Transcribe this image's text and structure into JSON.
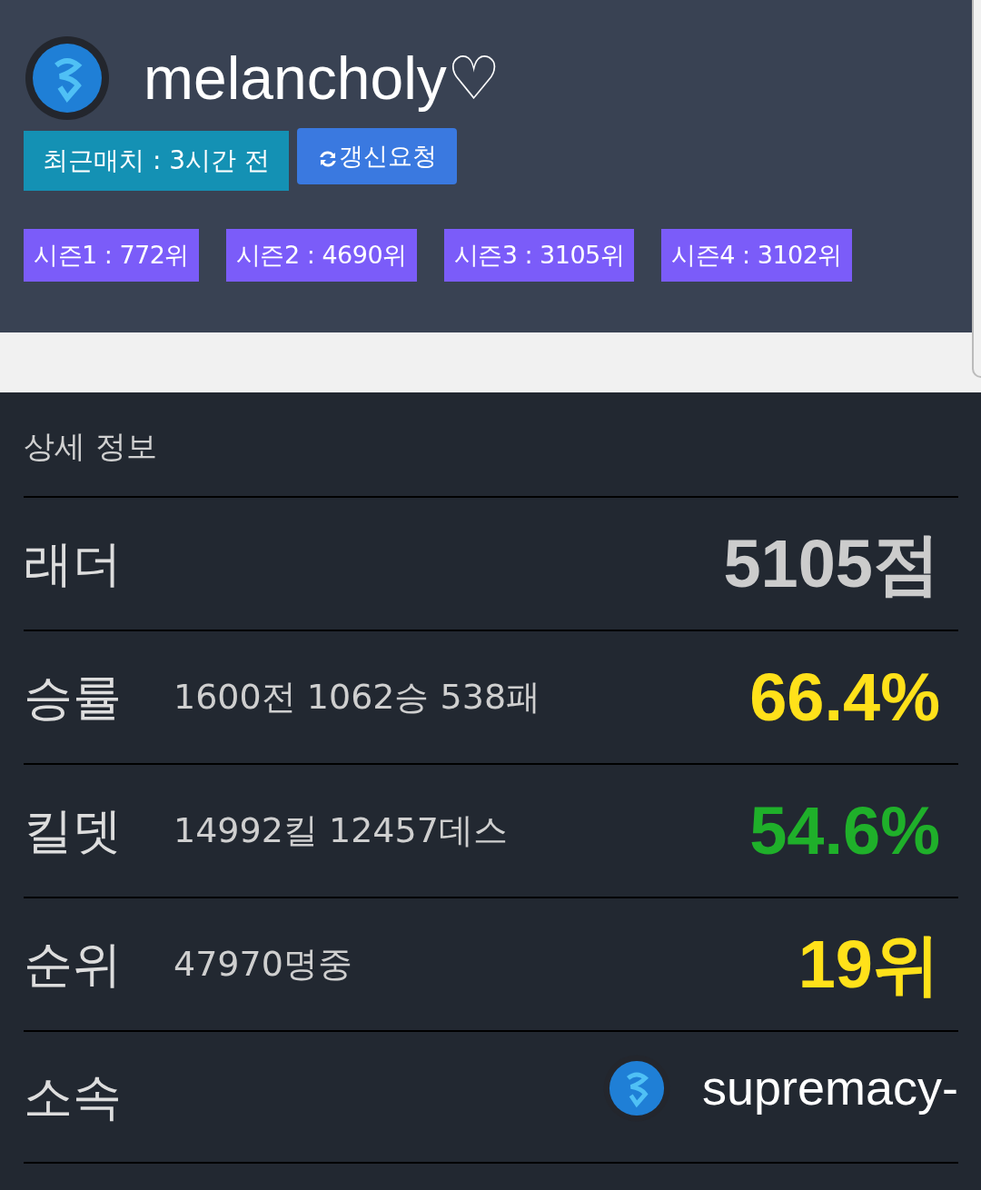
{
  "profile": {
    "name": "melancholy♡",
    "recent_match": "최근매치 : 3시간 전",
    "refresh_button": "갱신요청"
  },
  "seasons": [
    "시즌1 : 772위",
    "시즌2 : 4690위",
    "시즌3 : 3105위",
    "시즌4 : 3102위"
  ],
  "details": {
    "title": "상세 정보",
    "rows": [
      {
        "kind": "stat",
        "label": "래더",
        "value": "5105점",
        "color": "#cccccc"
      },
      {
        "kind": "stat",
        "label": "승률",
        "detail": "1600전 1062승 538패",
        "value": "66.4%",
        "color": "#ffe11a"
      },
      {
        "kind": "stat",
        "label": "킬뎃",
        "detail": "14992킬 12457데스",
        "value": "54.6%",
        "color": "#1fb02a"
      },
      {
        "kind": "stat",
        "label": "순위",
        "detail": "47970명중",
        "value": "19위",
        "color": "#ffe11a"
      },
      {
        "kind": "clan",
        "label": "소속",
        "value": "supremacy-"
      }
    ]
  }
}
